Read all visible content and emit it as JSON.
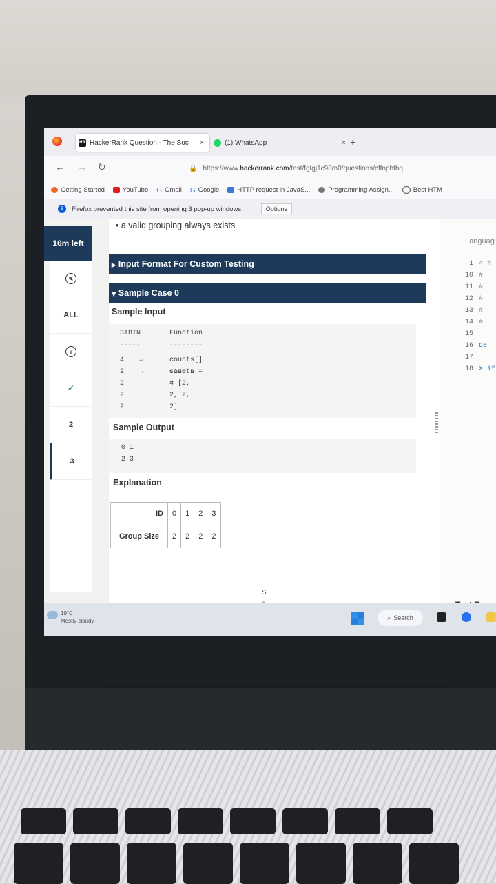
{
  "browser": {
    "tabs": [
      {
        "title": "HackerRank Question - The Soc",
        "close": "×"
      },
      {
        "title": "(1) WhatsApp",
        "close": "×"
      }
    ],
    "new_tab": "+",
    "url_prefix": "https://www.",
    "url_domain": "hackerrank.com",
    "url_rest": "/test/fgtgj1c98m0/questions/cffnpbtbq",
    "bookmarks": [
      "Getting Started",
      "YouTube",
      "Gmail",
      "Google",
      "HTTP request in JavaS...",
      "Programming Assign...",
      "Best HTM"
    ],
    "notification": "Firefox prevented this site from opening 3 pop-up windows.",
    "notification_button": "Options"
  },
  "sidebar": {
    "timer": "16m left",
    "items": [
      "ALL",
      "2",
      "3"
    ]
  },
  "problem": {
    "bullet": "a valid grouping always exists",
    "input_format_title": "Input Format For Custom Testing",
    "sample_case_title": "Sample Case 0",
    "sample_input_label": "Sample Input",
    "stdin_header": "STDIN",
    "function_header": "Function",
    "stdin_sep": "-----",
    "function_sep": "--------",
    "input_rows": [
      {
        "stdin": "4",
        "arrow": "→",
        "func": "counts[] size n = 4"
      },
      {
        "stdin": "2",
        "arrow": "→",
        "func": "counts = [2, 2, 2, 2]"
      },
      {
        "stdin": "2",
        "arrow": "",
        "func": ""
      },
      {
        "stdin": "2",
        "arrow": "",
        "func": ""
      },
      {
        "stdin": "2",
        "arrow": "",
        "func": ""
      }
    ],
    "sample_output_label": "Sample Output",
    "output_lines": [
      "0 1",
      "2 3"
    ],
    "explanation_label": "Explanation",
    "table": {
      "row1": [
        "ID",
        "0",
        "1",
        "2",
        "3"
      ],
      "row2": [
        "Group Size",
        "2",
        "2",
        "2",
        "2"
      ]
    },
    "partial_text": "S o"
  },
  "editor": {
    "language_label": "Languag",
    "lines": [
      {
        "num": "1",
        "text": "> #"
      },
      {
        "num": "10",
        "text": "#"
      },
      {
        "num": "11",
        "text": "#"
      },
      {
        "num": "12",
        "text": "#"
      },
      {
        "num": "13",
        "text": "#"
      },
      {
        "num": "14",
        "text": "#"
      },
      {
        "num": "15",
        "text": ""
      },
      {
        "num": "16",
        "text": "de"
      },
      {
        "num": "17",
        "text": ""
      },
      {
        "num": "18",
        "text": "> if"
      }
    ],
    "test_results": "Test Res"
  },
  "taskbar": {
    "temperature": "19°C",
    "condition": "Mostly cloudy",
    "search": "Search"
  }
}
